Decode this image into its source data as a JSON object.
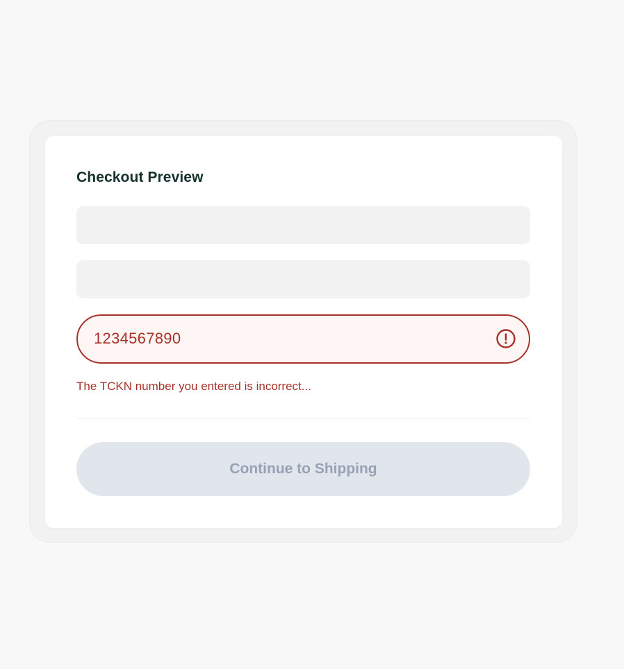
{
  "checkout": {
    "title": "Checkout Preview",
    "tckn": {
      "value": "1234567890",
      "error": "The TCKN number you entered is incorrect..."
    },
    "continue_label": "Continue to Shipping"
  },
  "icons": {
    "field_error": "alert-circle-icon"
  },
  "colors": {
    "error": "#a83129",
    "error_background": "#fdf6f4",
    "title": "#16302b",
    "disabled_button_background": "#e1e5ec",
    "disabled_button_text": "#97a3b4",
    "skeleton": "#f1f2f1"
  }
}
